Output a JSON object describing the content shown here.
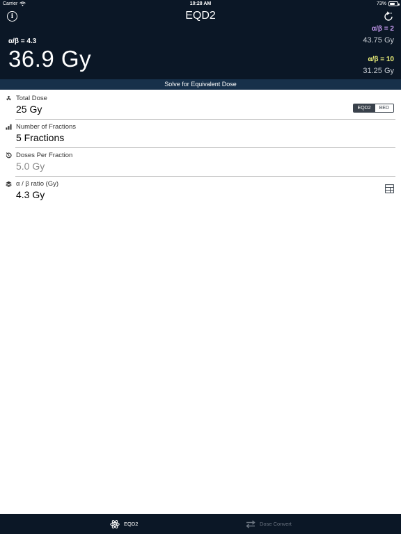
{
  "status_bar": {
    "carrier": "Carrier",
    "time": "10:28 AM",
    "battery": "73%",
    "battery_level": 0.73
  },
  "header": {
    "title": "EQD2",
    "ab_label": "α/β = 4.3",
    "main_value": "36.9 Gy",
    "alternates": [
      {
        "label": "α/β = 2",
        "value": "43.75 Gy",
        "color": "#c79bf2"
      },
      {
        "label": "α/β = 10",
        "value": "31.25 Gy",
        "color": "#eef27a"
      }
    ]
  },
  "banner": {
    "text": "Solve for Equivalent Dose"
  },
  "fields": [
    {
      "label": "Total Dose",
      "value": "25 Gy",
      "icon": "radiation-icon"
    },
    {
      "label": "Number of Fractions",
      "value": "5 Fractions",
      "icon": "bar-chart-icon"
    },
    {
      "label": "Doses Per Fraction",
      "value": "5.0 Gy",
      "icon": "history-icon"
    },
    {
      "label": "α / β ratio (Gy)",
      "value": "4.3 Gy",
      "icon": "layers-icon"
    }
  ],
  "mode_toggle": {
    "options": [
      "EQD2",
      "BED"
    ],
    "selected": "EQD2"
  },
  "tabs": [
    {
      "label": "EQD2",
      "active": true,
      "icon": "atom-icon"
    },
    {
      "label": "Dose Convert",
      "active": false,
      "icon": "swap-arrows-icon"
    }
  ],
  "colors": {
    "header_bg": "#0b1726",
    "banner_bg": "#17304a",
    "ab2_color": "#c79bf2",
    "ab10_color": "#eef27a"
  }
}
